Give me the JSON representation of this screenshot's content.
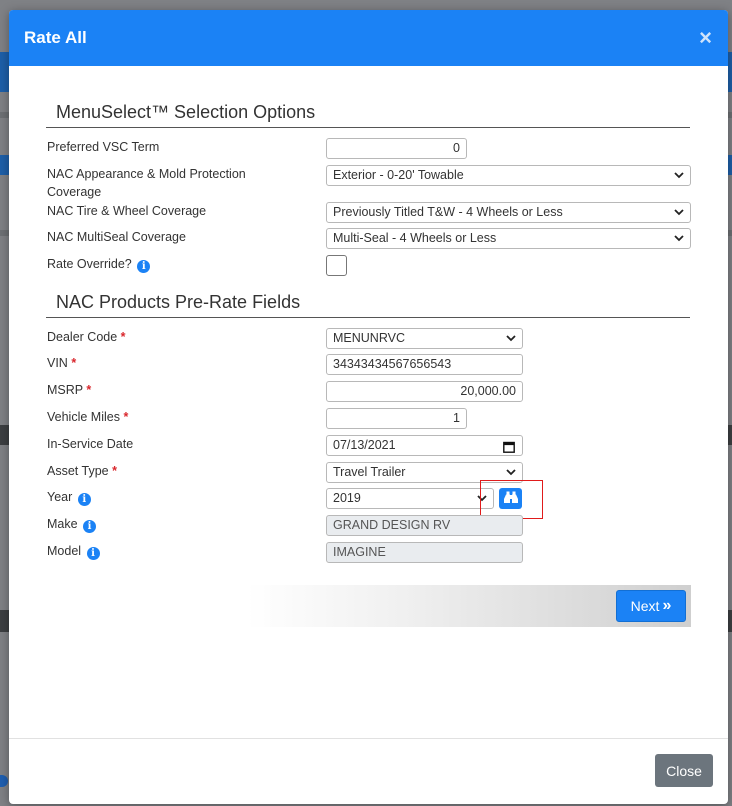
{
  "modal": {
    "title": "Rate All",
    "close_symbol": "×"
  },
  "menuselect": {
    "title": "MenuSelect™ Selection Options",
    "fields": {
      "vsc_term": {
        "label": "Preferred VSC Term",
        "value": "0"
      },
      "appearance": {
        "label": "NAC Appearance & Mold Protection Coverage",
        "value": "Exterior - 0-20' Towable"
      },
      "tire_wheel": {
        "label": "NAC Tire & Wheel Coverage",
        "value": "Previously Titled T&W - 4 Wheels or Less"
      },
      "multiseal": {
        "label": "NAC MultiSeal Coverage",
        "value": "Multi-Seal - 4 Wheels or Less"
      },
      "rate_override": {
        "label": "Rate Override?",
        "checked": false
      }
    }
  },
  "prerate": {
    "title": "NAC Products Pre-Rate Fields",
    "required_mark": "*",
    "fields": {
      "dealer_code": {
        "label": "Dealer Code",
        "value": "MENUNRVC"
      },
      "vin": {
        "label": "VIN",
        "value": "34343434567656543"
      },
      "msrp": {
        "label": "MSRP",
        "value": "20,000.00"
      },
      "vehicle_miles": {
        "label": "Vehicle Miles",
        "value": "1"
      },
      "in_service_date": {
        "label": "In-Service Date",
        "value": "07/13/2021"
      },
      "asset_type": {
        "label": "Asset Type",
        "value": "Travel Trailer"
      },
      "year": {
        "label": "Year",
        "value": "2019"
      },
      "make": {
        "label": "Make",
        "value": "GRAND DESIGN RV"
      },
      "model": {
        "label": "Model",
        "value": "IMAGINE"
      }
    }
  },
  "buttons": {
    "next": "Next",
    "next_icon": "»",
    "close": "Close"
  },
  "icons": {
    "info": "i",
    "search": "binoculars-icon"
  },
  "colors": {
    "primary": "#1b82f5",
    "required": "#d9262c",
    "highlight": "#e01b1b",
    "secondary": "#6c757d"
  }
}
